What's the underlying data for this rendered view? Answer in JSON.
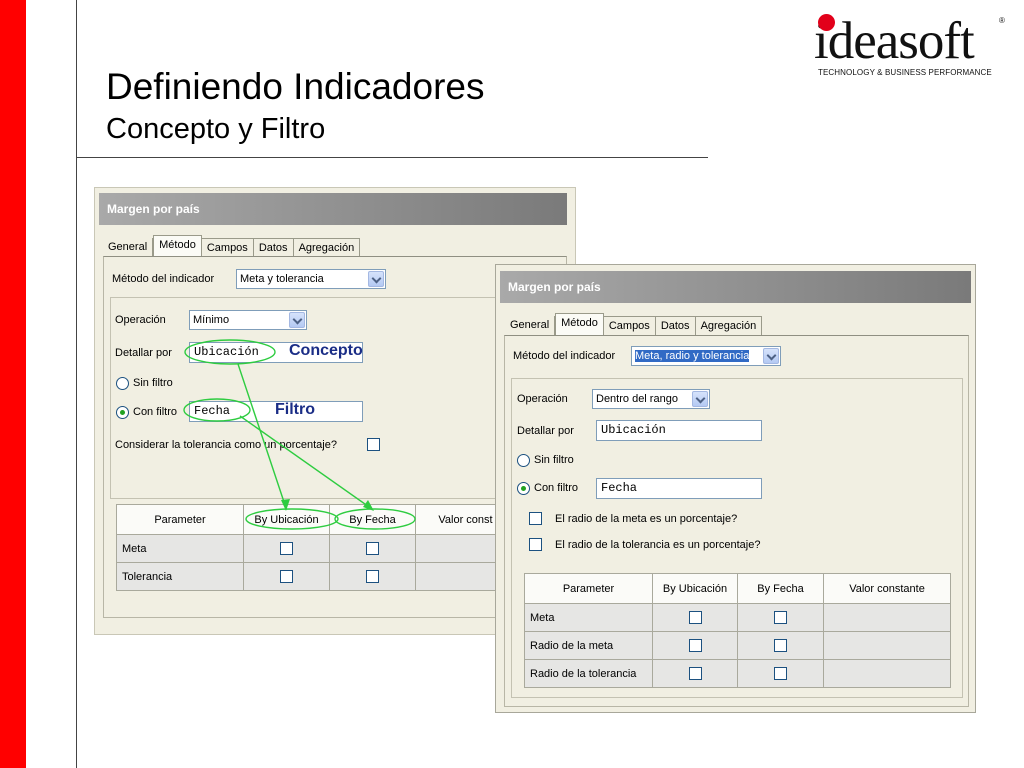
{
  "slide": {
    "title": "Definiendo Indicadores",
    "subtitle": "Concepto y Filtro"
  },
  "logo": {
    "word": "ideasoft",
    "registered": "®",
    "tagline": "TECHNOLOGY & BUSINESS PERFORMANCE"
  },
  "colors": {
    "side_bar": "#ff0000",
    "logo_dot": "#e2001a",
    "annotation_text": "#1a2d86",
    "annotation_lines": "#2ecc40"
  },
  "panel1": {
    "title": "Margen por país",
    "tabs": [
      "General",
      "Método",
      "Campos",
      "Datos",
      "Agregación"
    ],
    "active_tab": "Método",
    "method_label": "Método del indicador",
    "method_value": "Meta y tolerancia",
    "operation_label": "Operación",
    "operation_value": "Mínimo",
    "detail_label": "Detallar por",
    "detail_value": "Ubicación",
    "no_filter_label": "Sin filtro",
    "with_filter_label": "Con filtro",
    "filter_value": "Fecha",
    "tolerance_pct_label": "Considerar la tolerancia como un porcentaje?",
    "table": {
      "headers": [
        "Parameter",
        "By Ubicación",
        "By Fecha",
        "Valor const"
      ],
      "rows": [
        {
          "name": "Meta"
        },
        {
          "name": "Tolerancia"
        }
      ]
    },
    "annotations": {
      "concept": "Concepto",
      "filter": "Filtro"
    }
  },
  "panel2": {
    "title": "Margen por país",
    "tabs": [
      "General",
      "Método",
      "Campos",
      "Datos",
      "Agregación"
    ],
    "active_tab": "Método",
    "method_label": "Método del indicador",
    "method_value": "Meta, radio y tolerancia",
    "operation_label": "Operación",
    "operation_value": "Dentro del rango",
    "detail_label": "Detallar por",
    "detail_value": "Ubicación",
    "no_filter_label": "Sin filtro",
    "with_filter_label": "Con filtro",
    "filter_value": "Fecha",
    "goal_radius_pct_label": "El radio de la meta es un porcentaje?",
    "tolerance_radius_pct_label": "El radio de la tolerancia es un porcentaje?",
    "table": {
      "headers": [
        "Parameter",
        "By Ubicación",
        "By Fecha",
        "Valor constante"
      ],
      "rows": [
        {
          "name": "Meta"
        },
        {
          "name": "Radio de la meta"
        },
        {
          "name": "Radio de la tolerancia"
        }
      ]
    }
  }
}
